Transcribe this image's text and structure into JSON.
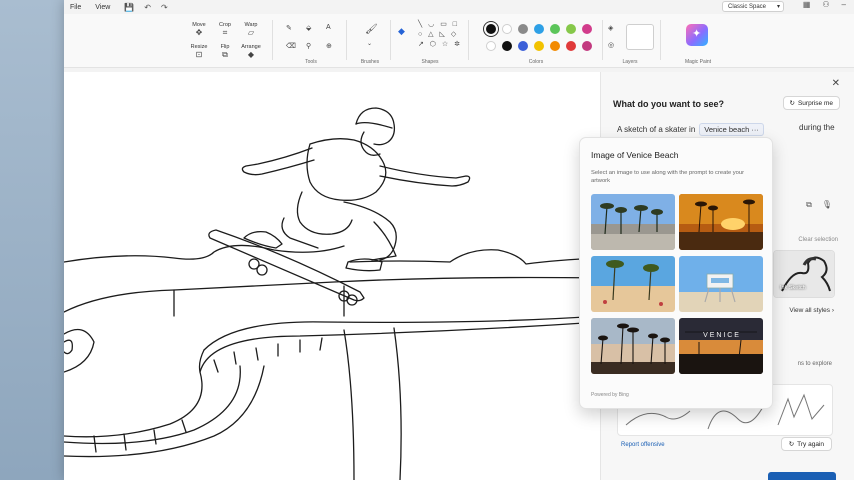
{
  "menu": {
    "file": "File",
    "view": "View"
  },
  "quick_icons": {
    "save": "💾",
    "undo": "↶",
    "redo": "↷"
  },
  "theme_select": {
    "value": "Classic Space"
  },
  "window_icons": {
    "grid": "▦",
    "user": "⚇",
    "minimize": "–"
  },
  "ribbon": {
    "move": "Move",
    "crop": "Crop",
    "warp": "Warp",
    "resize": "Resize",
    "flip": "Flip",
    "arrange": "Arrange",
    "tools_label": "Tools",
    "brushes_label": "Brushes",
    "shapes_label": "Shapes",
    "colors_label": "Colors",
    "layers_label": "Layers",
    "magic_label": "Magic Paint",
    "colors": {
      "row1": [
        "#101010",
        "#ffffff",
        "#8a8a8a",
        "#2ea0e6",
        "#5cc55a",
        "#86c84a",
        "#d23c8c"
      ],
      "row2": [
        "#ffffff",
        "#111111",
        "#3b5fd8",
        "#f2c200",
        "#f28a00",
        "#e03a3a",
        "#c2397f"
      ]
    }
  },
  "panel": {
    "close": "✕",
    "title": "What do you want to see?",
    "surprise": "Surprise me",
    "prompt_prefix": "A sketch of a skater in",
    "prompt_chip": "Venice beach",
    "prompt_suffix": "during the",
    "clear_selection": "Clear selection",
    "style_label": "Ink Sketch",
    "view_all": "View all styles",
    "explore": "ns to explore",
    "report": "Report offensive",
    "try_again": "Try again"
  },
  "popup": {
    "title": "Image of Venice Beach",
    "description": "Select an image to use along with the prompt to create your artwork",
    "powered_by": "Powered by Bing",
    "thumbs": [
      "Venice Beach palms skatepark",
      "Sunset palm trees",
      "Beach palms and sand",
      "Lifeguard tower",
      "Palm trees at dusk",
      "VENICE sign at sunset"
    ],
    "venice_sign": "V E N I C E"
  },
  "colors": {
    "accent": "#1a5fb4",
    "canvas": "#ffffff",
    "panel": "#f7f7f7"
  }
}
